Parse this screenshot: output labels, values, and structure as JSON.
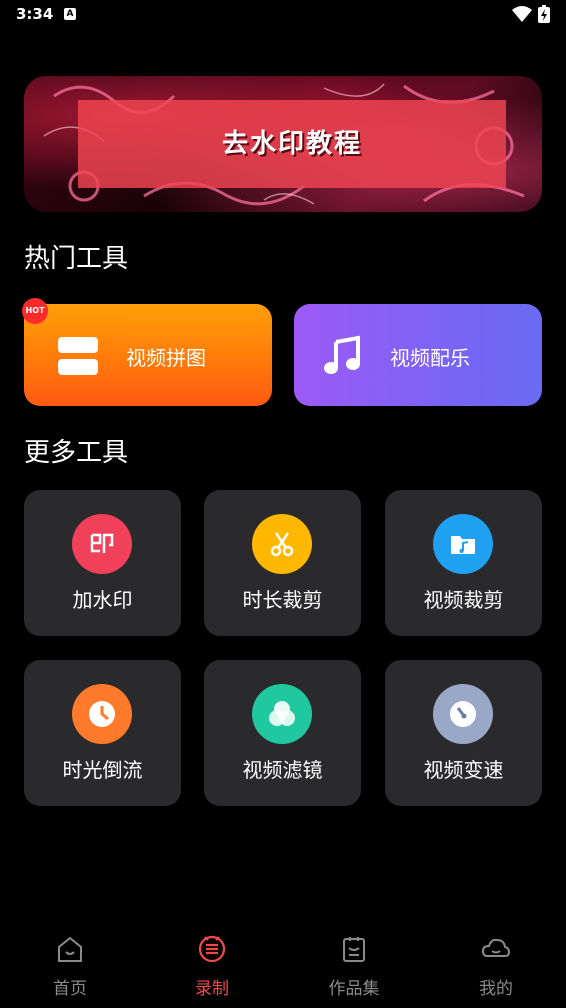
{
  "status_bar": {
    "time": "3:34",
    "notification_icon": "a-letter-icon"
  },
  "banner": {
    "title": "去水印教程"
  },
  "sections": {
    "hot_tools_title": "热门工具",
    "more_tools_title": "更多工具"
  },
  "hot_tools": [
    {
      "label": "视频拼图",
      "icon": "layout-icon",
      "badge": "HOT"
    },
    {
      "label": "视频配乐",
      "icon": "music-note-icon"
    }
  ],
  "more_tools": [
    {
      "label": "加水印",
      "icon": "stamp-icon",
      "color": "#f0405a"
    },
    {
      "label": "时长裁剪",
      "icon": "scissors-icon",
      "color": "#ffb800"
    },
    {
      "label": "视频裁剪",
      "icon": "folder-music-icon",
      "color": "#1fa0f0"
    },
    {
      "label": "时光倒流",
      "icon": "clock-icon",
      "color": "#ff7a2a"
    },
    {
      "label": "视频滤镜",
      "icon": "filter-circles-icon",
      "color": "#20c8a0"
    },
    {
      "label": "视频变速",
      "icon": "speed-dial-icon",
      "color": "#9aa8c8"
    }
  ],
  "bottom_nav": [
    {
      "label": "首页",
      "icon": "home-icon",
      "active": false
    },
    {
      "label": "录制",
      "icon": "record-icon",
      "active": true
    },
    {
      "label": "作品集",
      "icon": "portfolio-icon",
      "active": false
    },
    {
      "label": "我的",
      "icon": "profile-cloud-icon",
      "active": false
    }
  ],
  "colors": {
    "accent": "#f04a4a",
    "background": "#000000",
    "tile": "#2a2a2c"
  }
}
